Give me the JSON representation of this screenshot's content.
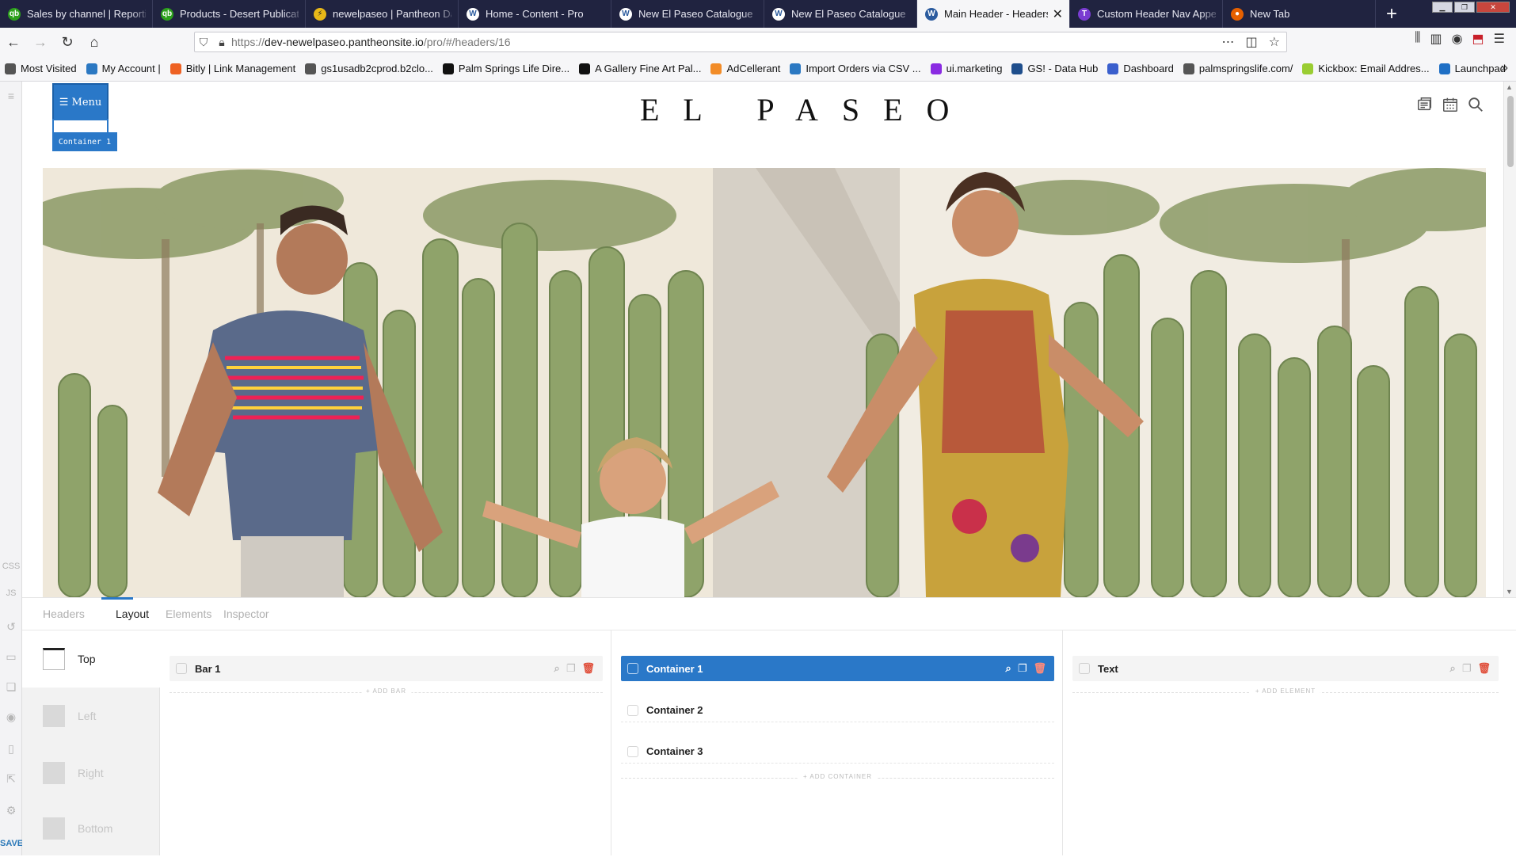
{
  "browser": {
    "tabs": [
      {
        "title": "Sales by channel | Reporting",
        "icon": "qb-icon",
        "color": "#2ca01c",
        "glyph": "qb"
      },
      {
        "title": "Products - Desert Publications",
        "icon": "qb-icon",
        "color": "#2ca01c",
        "glyph": "qb"
      },
      {
        "title": "newelpaseo | Pantheon Dashboard",
        "icon": "pantheon-icon",
        "color": "#e8b818",
        "glyph": "⚡"
      },
      {
        "title": "Home - Content - Pro",
        "icon": "wordpress-icon",
        "color": "#2b5b9e",
        "glyph": "W"
      },
      {
        "title": "New El Paseo Catalogue",
        "icon": "wordpress-icon",
        "color": "#2b5b9e",
        "glyph": "W"
      },
      {
        "title": "New El Paseo Catalogue",
        "icon": "wordpress-icon",
        "color": "#2b5b9e",
        "glyph": "W"
      },
      {
        "title": "Main Header - Headers - Pro",
        "icon": "wordpress-icon",
        "color": "#2b5b9e",
        "glyph": "W",
        "active": true
      },
      {
        "title": "Custom Header Nav Appearance",
        "icon": "theme-icon",
        "color": "#7a3cd1",
        "glyph": "T"
      },
      {
        "title": "New Tab",
        "icon": "firefox-icon",
        "color": "#e66000",
        "glyph": "●"
      }
    ],
    "url": {
      "protocol": "https://",
      "host": "dev-newelpaseo.pantheonsite.io",
      "path": "/pro/#/headers/16"
    },
    "bookmarks": [
      {
        "label": "Most Visited",
        "icon": "gear-icon",
        "color": "#555"
      },
      {
        "label": "My Account |",
        "icon": "wifi-icon",
        "color": "#2b78c2"
      },
      {
        "label": "Bitly | Link Management",
        "icon": "bitly-icon",
        "color": "#ee6123"
      },
      {
        "label": "gs1usadb2cprod.b2clo...",
        "icon": "globe-icon",
        "color": "#555"
      },
      {
        "label": "Palm Springs Life Dire...",
        "icon": "psl-icon",
        "color": "#111"
      },
      {
        "label": "A Gallery Fine Art Pal...",
        "icon": "psl-icon",
        "color": "#111"
      },
      {
        "label": "AdCellerant",
        "icon": "adcellerant-icon",
        "color": "#f28c28"
      },
      {
        "label": "Import Orders via CSV ...",
        "icon": "gear-icon",
        "color": "#2b78c2"
      },
      {
        "label": "ui.marketing",
        "icon": "circle-icon",
        "color": "#8a2be2"
      },
      {
        "label": "GS! - Data Hub",
        "icon": "globe-icon",
        "color": "#1f4e8c"
      },
      {
        "label": "Dashboard",
        "icon": "dashboard-icon",
        "color": "#3a5fcd"
      },
      {
        "label": "palmspringslife.com/",
        "icon": "globe-icon",
        "color": "#555"
      },
      {
        "label": "Kickbox: Email Addres...",
        "icon": "kickbox-icon",
        "color": "#9acd32"
      },
      {
        "label": "Launchpad",
        "icon": "launchpad-icon",
        "color": "#1f6fc5"
      }
    ]
  },
  "left_strip": {
    "css": "CSS",
    "js": "JS",
    "save": "SAVE"
  },
  "preview": {
    "menu_label": "☰ Menu",
    "container_tag": "Container 1",
    "logo": "EL PASEO"
  },
  "editor": {
    "tabs": [
      "Headers",
      "Layout",
      "Elements",
      "Inspector"
    ],
    "active_tab": "Layout",
    "zones": [
      "Top",
      "Left",
      "Right",
      "Bottom"
    ],
    "active_zone": "Top",
    "bars": [
      "Bar 1"
    ],
    "add_bar": "+ ADD BAR",
    "containers": [
      "Container 1",
      "Container 2",
      "Container 3"
    ],
    "add_container": "+ ADD CONTAINER",
    "elements": [
      "Text"
    ],
    "add_element": "+ ADD ELEMENT"
  },
  "colors": {
    "accent": "#2a78c8",
    "delete": "#e0503c",
    "tabbar": "#202340"
  }
}
